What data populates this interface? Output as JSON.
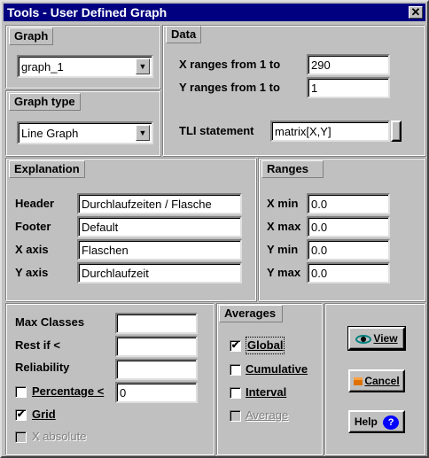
{
  "window": {
    "title": "Tools - User Defined Graph",
    "close_glyph": "✕"
  },
  "graph": {
    "title": "Graph",
    "value": "graph_1"
  },
  "graph_type": {
    "title": "Graph type",
    "value": "Line Graph"
  },
  "data": {
    "title": "Data",
    "x_label": "X ranges from 1 to",
    "x_value": "290",
    "y_label": "Y ranges from 1 to",
    "y_value": "1",
    "tli_label": "TLI statement",
    "tli_value": "matrix[X,Y]"
  },
  "explanation": {
    "title": "Explanation",
    "header_label": "Header",
    "header_value": "Durchlaufzeiten / Flasche",
    "footer_label": "Footer",
    "footer_value": "Default",
    "xaxis_label": "X axis",
    "xaxis_value": "Flaschen",
    "yaxis_label": "Y axis",
    "yaxis_value": "Durchlaufzeit"
  },
  "ranges": {
    "title": "Ranges",
    "xmin_label": "X min",
    "xmin_value": "0.0",
    "xmax_label": "X max",
    "xmax_value": "0.0",
    "ymin_label": "Y min",
    "ymin_value": "0.0",
    "ymax_label": "Y max",
    "ymax_value": "0.0"
  },
  "options": {
    "max_classes_label": "Max Classes",
    "max_classes_value": "",
    "rest_label": "Rest if <",
    "rest_value": "",
    "reliability_label": "Reliability",
    "reliability_value": "",
    "percentage_label": "Percentage <",
    "percentage_value": "0",
    "percentage_checked": false,
    "grid_label": "Grid",
    "grid_checked": true,
    "xabs_label": "X absolute",
    "xabs_checked": false
  },
  "averages": {
    "title": "Averages",
    "global_label": "Global",
    "global_checked": true,
    "cumulative_label": "Cumulative",
    "interval_label": "Interval",
    "average_label": "Average"
  },
  "buttons": {
    "view": "View",
    "cancel": "Cancel",
    "help": "Help"
  },
  "glyphs": {
    "check": "✔",
    "dropdown": "▼"
  },
  "colors": {
    "titlebar": "#000080",
    "face": "#c0c0c0"
  }
}
